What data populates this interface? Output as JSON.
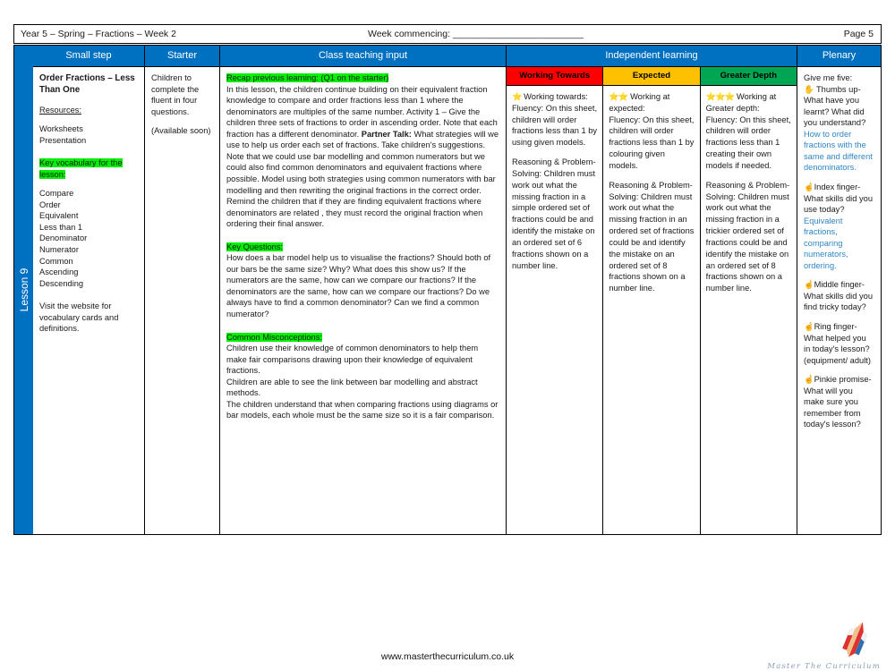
{
  "header": {
    "title": "Year 5 – Spring – Fractions – Week 2",
    "week_commencing": "Week commencing: _________________________",
    "page": "Page 5"
  },
  "spine": {
    "lesson_label": "Lesson 9"
  },
  "columns": {
    "small_step": "Small step",
    "starter": "Starter",
    "class_teaching_input": "Class teaching input",
    "independent_learning": "Independent learning",
    "plenary": "Plenary"
  },
  "small_step": {
    "title": "Order Fractions – Less Than One",
    "resources_label": "Resources:",
    "resources": [
      "Worksheets",
      "Presentation"
    ],
    "key_vocab_heading": "Key vocabulary for the lesson:",
    "vocabulary": [
      "Compare",
      "Order",
      "Equivalent",
      "Less than 1",
      "Denominator",
      "Numerator",
      "Common",
      "Ascending",
      "Descending"
    ],
    "website_note": "Visit the website for vocabulary cards and definitions."
  },
  "starter": {
    "line1": "Children to complete the fluent in four questions.",
    "line2": "(Available soon)"
  },
  "class_teaching_input": {
    "recap_heading": "Recap previous learning: (Q1 on the starter)",
    "recap_body_1": "In this lesson, the children continue building on their equivalent fraction knowledge to compare and order fractions less than 1 where the denominators are multiples of the same number. Activity 1 – Give the children three sets of fractions to order in ascending order. Note that each fraction has a different denominator. ",
    "partner_talk_label": "Partner Talk:",
    "recap_body_2": " What strategies will we use to help us order each set of fractions. Take children's suggestions. Note that we could use bar modelling and common numerators but we could also find common denominators and equivalent fractions where possible. Model using both strategies using common numerators with bar modelling and then rewriting the original fractions in the correct order. Remind the children that if they are finding equivalent fractions where denominators are related , they must record the original fraction when ordering their final answer.",
    "key_questions_heading": "Key Questions:",
    "key_questions_body": "How does a bar model help us to visualise the fractions? Should both of our bars be the same size? Why? What does this show us? If the numerators are the same, how can we compare our fractions? If the denominators are the same, how can we compare our fractions? Do we always have to find a common denominator? Can we find a common numerator?",
    "misconceptions_heading": "Common Misconceptions:",
    "misconceptions_body_1": "Children use their knowledge of common denominators to help them make fair comparisons drawing upon their knowledge of equivalent fractions.",
    "misconceptions_body_2": "Children are able to see the link between bar modelling and abstract methods.",
    "misconceptions_body_3": "The children understand that when comparing fractions using diagrams or bar models, each whole must be the same size so it is a fair comparison."
  },
  "independent_learning": {
    "bands": [
      {
        "name": "Working Towards",
        "color": "#FF0000",
        "text_color": "#000000",
        "stars": "⭐",
        "heading": " Working towards:",
        "fluency": "Fluency: On this sheet, children will order fractions less than 1 by using given models.",
        "reasoning": "Reasoning & Problem-Solving: Children must work out what the missing fraction in a simple ordered set of fractions could be and identify the mistake on an ordered set of  6 fractions shown on a number line."
      },
      {
        "name": "Expected",
        "color": "#FFC000",
        "text_color": "#000000",
        "stars": "⭐⭐",
        "heading": " Working at expected:",
        "fluency": "Fluency: On this sheet, children will order fractions less than 1 by colouring given models.",
        "reasoning": "Reasoning & Problem-Solving: Children must work out what the missing fraction in an ordered set of fractions could be and identify the mistake on an ordered set of 8 fractions shown on a number line."
      },
      {
        "name": "Greater Depth",
        "color": "#00A651",
        "text_color": "#000000",
        "stars": "⭐⭐⭐",
        "heading": " Working at Greater depth:",
        "fluency": "Fluency: On this sheet, children will order fractions less than 1 creating their own models if needed.",
        "reasoning": "Reasoning & Problem-Solving: Children must work out what the missing fraction in a trickier ordered set of fractions could be and identify the mistake on an ordered set of 8 fractions shown on a number line."
      }
    ]
  },
  "plenary": {
    "intro": "Give me five:",
    "items": [
      {
        "icon": "✋",
        "question": "Thumbs up- What have you learnt? What did you understand?",
        "answer": "How to order fractions with the same and different denominators."
      },
      {
        "icon": "☝",
        "question": "Index finger- What skills did you use today?",
        "answer": "Equivalent fractions, comparing numerators, ordering."
      },
      {
        "icon": "☝",
        "question": "Middle finger- What skills did you find tricky today?",
        "answer": ""
      },
      {
        "icon": "☝",
        "question": "Ring finger- What helped you in today's lesson? (equipment/ adult)",
        "answer": ""
      },
      {
        "icon": "☝",
        "question": "Pinkie promise- What will you make sure you remember from today's lesson?",
        "answer": ""
      }
    ]
  },
  "footer": {
    "url": "www.masterthecurriculum.co.uk",
    "logo_text": "Master  The  Curriculum"
  }
}
